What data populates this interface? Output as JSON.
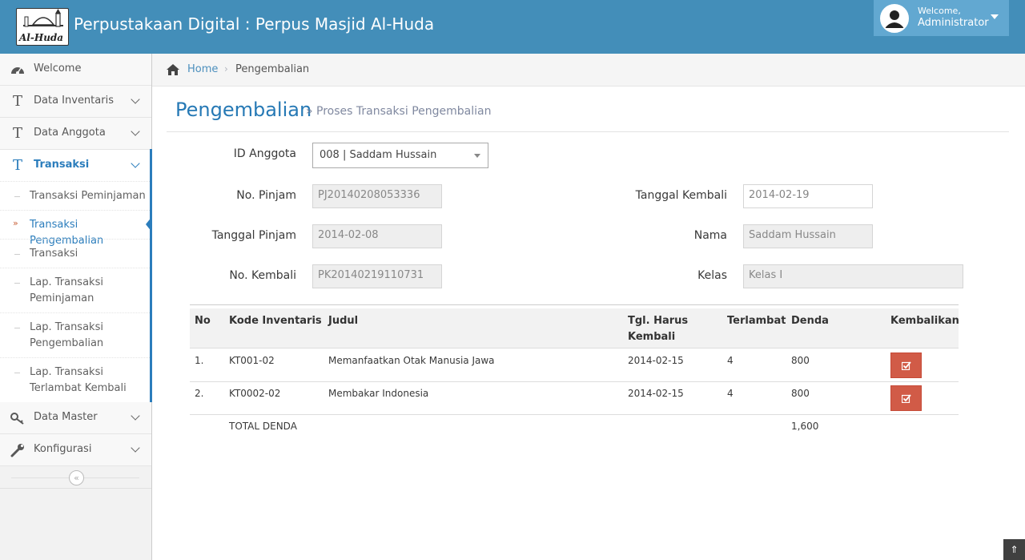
{
  "header": {
    "logo_text": "Al-Huda",
    "title": "Perpustakaan Digital : Perpus Masjid Al-Huda",
    "user_welcome": "Welcome,",
    "user_name": "Administrator"
  },
  "sidebar": {
    "items": [
      {
        "label": "Welcome",
        "icon": "dashboard-icon"
      },
      {
        "label": "Data Inventaris",
        "icon": "text-icon"
      },
      {
        "label": "Data Anggota",
        "icon": "text-icon"
      },
      {
        "label": "Transaksi",
        "icon": "text-icon"
      },
      {
        "label": "Data Master",
        "icon": "keys-icon"
      },
      {
        "label": "Konfigurasi",
        "icon": "wrench-icon"
      }
    ],
    "submenu": [
      {
        "label": "Transaksi Peminjaman"
      },
      {
        "label": "Transaksi Pengembalian"
      },
      {
        "label": "Transaksi"
      },
      {
        "label": "Lap. Transaksi Peminjaman"
      },
      {
        "label": "Lap. Transaksi Pengembalian"
      },
      {
        "label": "Lap. Transaksi Terlambat Kembali"
      }
    ],
    "active_color": "#2b7dbc"
  },
  "breadcrumb": {
    "home": "Home",
    "current": "Pengembalian"
  },
  "page": {
    "title": "Pengembalian",
    "subtitle": "» Proses Transaksi Pengembalian"
  },
  "form": {
    "id_anggota_label": "ID Anggota",
    "id_anggota_value": "008 | Saddam Hussain",
    "no_pinjam_label": "No. Pinjam",
    "no_pinjam_value": "PJ20140208053336",
    "tanggal_pinjam_label": "Tanggal Pinjam",
    "tanggal_pinjam_value": "2014-02-08",
    "no_kembali_label": "No. Kembali",
    "no_kembali_value": "PK20140219110731",
    "tanggal_kembali_label": "Tanggal Kembali",
    "tanggal_kembali_value": "2014-02-19",
    "nama_label": "Nama",
    "nama_value": "Saddam Hussain",
    "kelas_label": "Kelas",
    "kelas_value": "Kelas I"
  },
  "table": {
    "headers": {
      "no": "No",
      "kode": "Kode Inventaris",
      "judul": "Judul",
      "tgl_line1": "Tgl. Harus",
      "tgl_line2": "Kembali",
      "terlambat": "Terlambat",
      "denda": "Denda",
      "kembalikan": "Kembalikan"
    },
    "rows": [
      {
        "no": "1.",
        "kode": "KT001-02",
        "judul": "Memanfaatkan Otak Manusia Jawa",
        "tgl": "2014-02-15",
        "terlambat": "4",
        "denda": "800"
      },
      {
        "no": "2.",
        "kode": "KT0002-02",
        "judul": "Membakar Indonesia",
        "tgl": "2014-02-15",
        "terlambat": "4",
        "denda": "800"
      }
    ],
    "total_label": "TOTAL DENDA",
    "total_value": "1,600",
    "button_color": "#d15b47"
  }
}
